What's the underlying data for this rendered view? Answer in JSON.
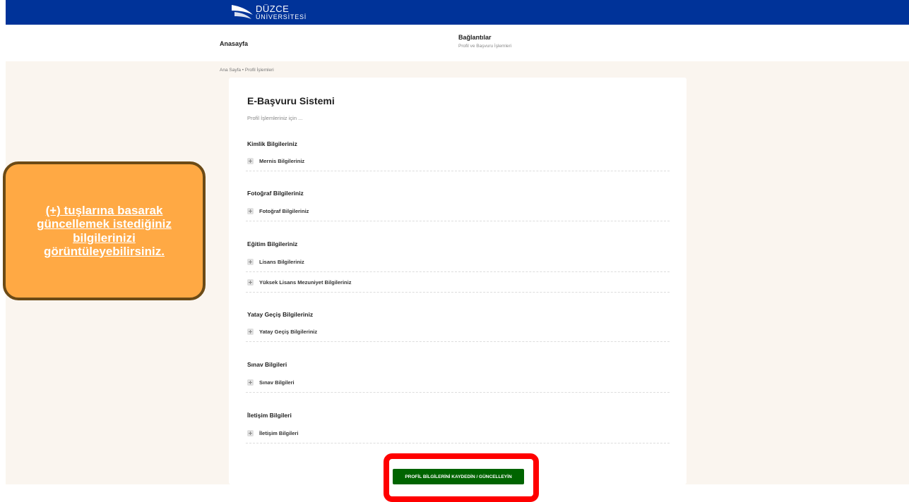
{
  "brand": {
    "line1": "DÜZCE",
    "line2": "ÜNİVERSİTESİ",
    "color": "#003399"
  },
  "nav": {
    "home": "Anasayfa",
    "links_title": "Bağlantılar",
    "links_sub": "Profil ve Başvuru İşlemleri"
  },
  "breadcrumb": "Ana Sayfa  •  Profil İşlemleri",
  "card": {
    "title": "E-Başvuru Sistemi",
    "subtitle": "Profil İşlemleriniz için ..."
  },
  "sections": {
    "kimlik": {
      "title": "Kimlik Bilgileriniz",
      "items": [
        "Mernis Bilgileriniz"
      ]
    },
    "fotograf": {
      "title": "Fotoğraf Bilgileriniz",
      "items": [
        "Fotoğraf Bilgileriniz"
      ]
    },
    "egitim": {
      "title": "Eğitim Bilgileriniz",
      "items": [
        "Lisans Bilgileriniz",
        "Yüksek Lisans Mezuniyet Bilgileriniz"
      ]
    },
    "yatay": {
      "title": "Yatay Geçiş Bilgileriniz",
      "items": [
        "Yatay Geçiş Bilgileriniz"
      ]
    },
    "sinav": {
      "title": "Sınav Bilgileri",
      "items": [
        "Sınav Bilgileri"
      ]
    },
    "iletisim": {
      "title": "İletişim Bilgileri",
      "items": [
        "İletişim Bilgileri"
      ]
    }
  },
  "callout": {
    "text": "(+) tuşlarına basarak güncellemek istediğiniz bilgilerinizi görüntüleyebilirsiniz."
  },
  "save_button": "PROFİL BİLGİLERİNİ KAYDEDİN / GÜNCELLEYİN",
  "colors": {
    "header": "#003399",
    "page_bg": "#faf5ef",
    "callout_fill": "#ffa944",
    "callout_border": "#6b4a16",
    "highlight": "#ff0000",
    "button": "#006400"
  }
}
